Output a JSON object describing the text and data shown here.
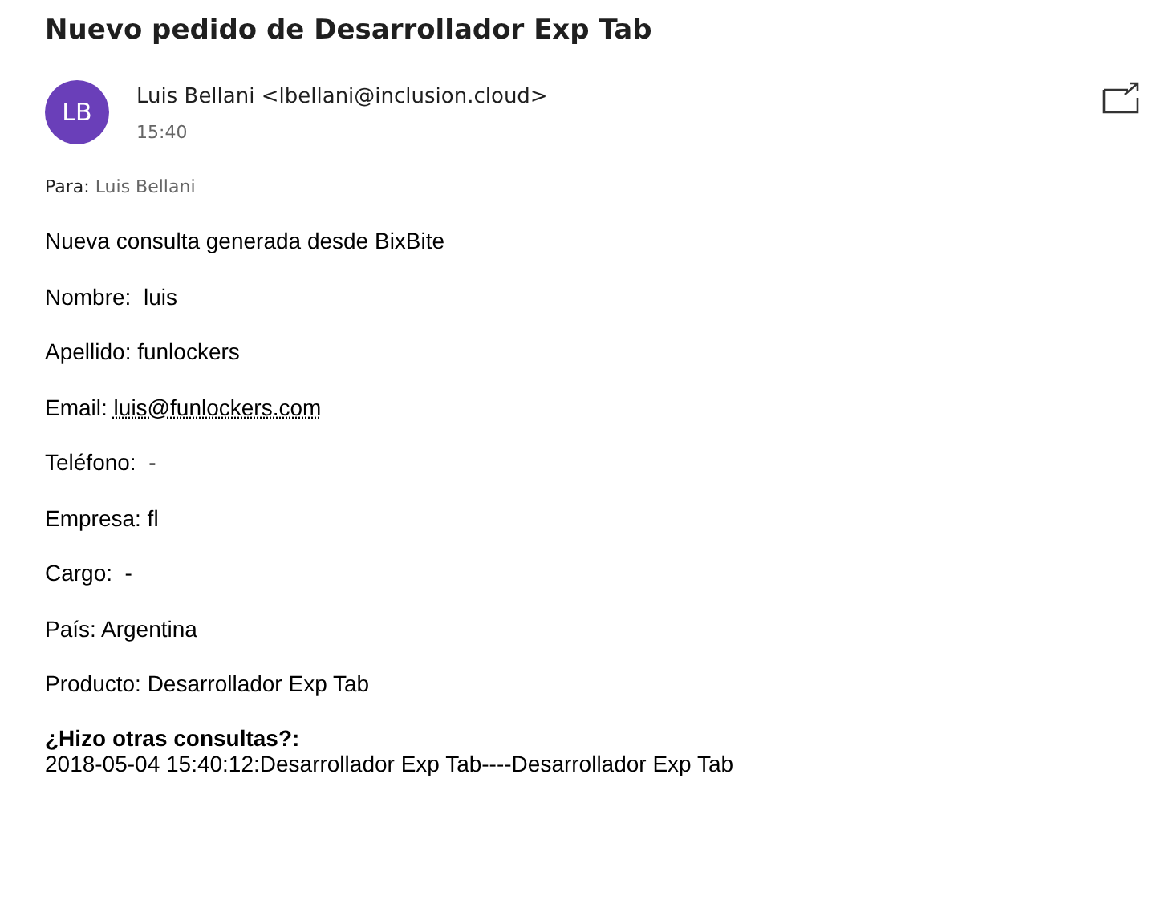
{
  "subject": "Nuevo pedido de Desarrollador Exp Tab",
  "sender": {
    "initials": "LB",
    "name": "Luis Bellani",
    "address": "<lbellani@inclusion.cloud>",
    "time": "15:40"
  },
  "to": {
    "label": "Para:",
    "value": "Luis Bellani"
  },
  "body": {
    "intro": "Nueva consulta generada desde BixBite",
    "lines": [
      {
        "kind": "text",
        "text": "Nombre:  luis"
      },
      {
        "kind": "text",
        "text": "Apellido: funlockers"
      },
      {
        "kind": "link",
        "text": "Email:",
        "link": "luis@funlockers.com"
      },
      {
        "kind": "text",
        "text": "Teléfono:  -"
      },
      {
        "kind": "text",
        "text": "Empresa: fl"
      },
      {
        "kind": "text",
        "text": "Cargo:  -"
      },
      {
        "kind": "text",
        "text": "País: Argentina"
      },
      {
        "kind": "text",
        "text": "Producto: Desarrollador Exp Tab"
      }
    ],
    "history": {
      "heading": "¿Hizo otras consultas?:",
      "entry": "2018-05-04 15:40:12:Desarrollador Exp Tab----Desarrollador Exp Tab"
    }
  }
}
